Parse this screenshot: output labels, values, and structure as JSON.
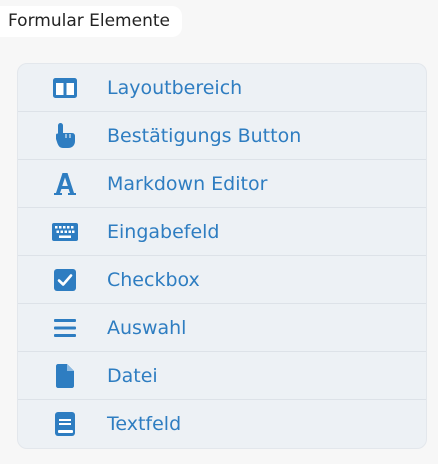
{
  "panel": {
    "title": "Formular Elemente"
  },
  "colors": {
    "accent": "#2e7dc1",
    "list_background": "#edf1f5",
    "divider": "#dde2e8"
  },
  "elements": [
    {
      "label": "Layoutbereich",
      "icon": "layout-columns-icon"
    },
    {
      "label": "Bestätigungs Button",
      "icon": "pointing-hand-icon"
    },
    {
      "label": "Markdown Editor",
      "icon": "font-letter-a-icon"
    },
    {
      "label": "Eingabefeld",
      "icon": "keyboard-icon"
    },
    {
      "label": "Checkbox",
      "icon": "checked-checkbox-icon"
    },
    {
      "label": "Auswahl",
      "icon": "list-lines-icon"
    },
    {
      "label": "Datei",
      "icon": "file-icon"
    },
    {
      "label": "Textfeld",
      "icon": "book-icon"
    }
  ]
}
